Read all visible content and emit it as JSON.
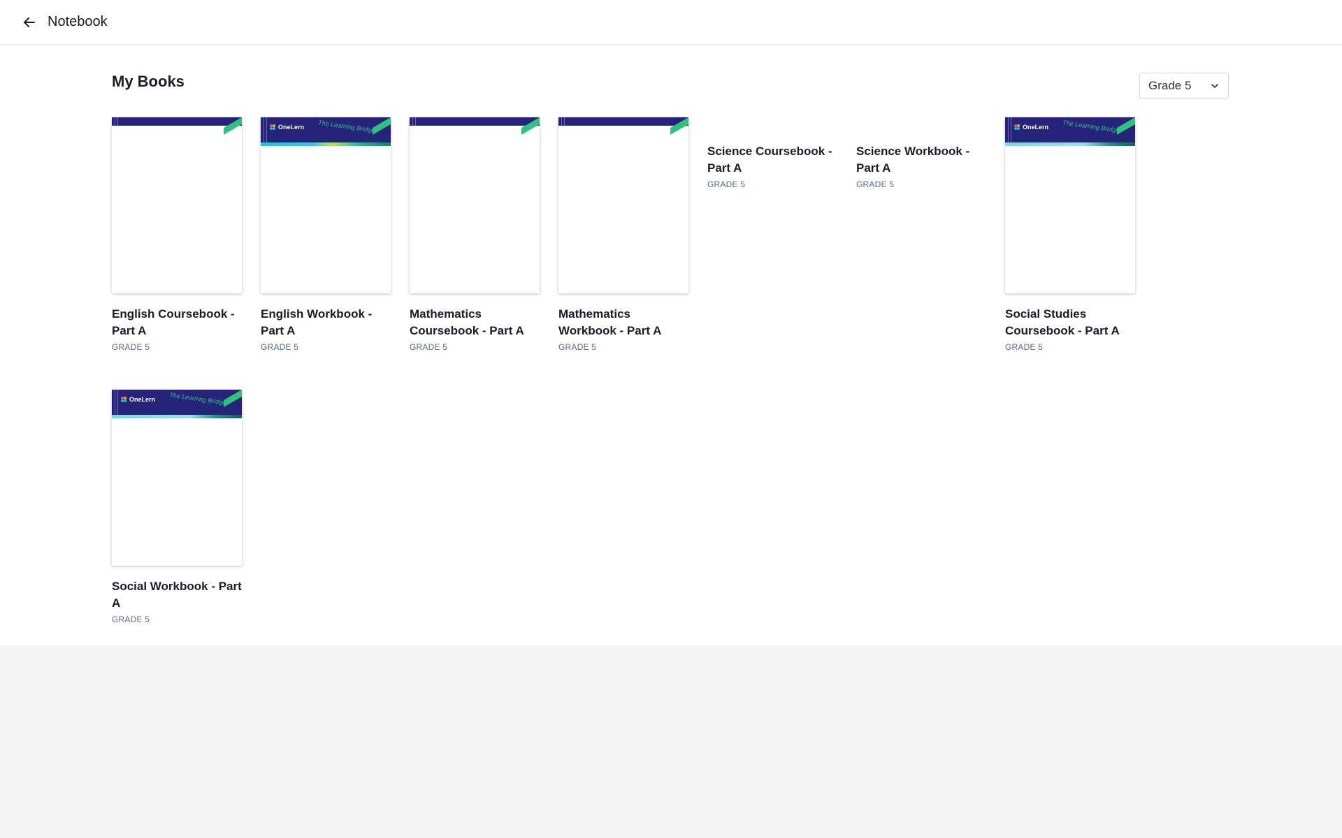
{
  "header": {
    "back_label": "back",
    "title": "Notebook"
  },
  "main": {
    "section_title": "My Books",
    "grade_filter": {
      "selected": "Grade 5"
    }
  },
  "cover_branding": {
    "brand": "OneLern",
    "tagline": "The Learning Bridge"
  },
  "books": [
    {
      "title": "English Coursebook - Part A",
      "grade": "GRADE 5"
    },
    {
      "title": "English Workbook - Part A",
      "grade": "GRADE 5"
    },
    {
      "title": "Mathematics Coursebook - Part A",
      "grade": "GRADE 5"
    },
    {
      "title": "Mathematics Workbook - Part A",
      "grade": "GRADE 5"
    },
    {
      "title": "Science Coursebook - Part A",
      "grade": "GRADE 5"
    },
    {
      "title": "Science Workbook - Part A",
      "grade": "GRADE 5"
    },
    {
      "title": "Social Studies Coursebook - Part A",
      "grade": "GRADE 5"
    },
    {
      "title": "Social Workbook - Part A",
      "grade": "GRADE 5"
    }
  ],
  "colors": {
    "cover_band": "#26237a",
    "accent_green": "#2ec27e",
    "text_primary": "#1c1c28",
    "text_muted": "#5c6880"
  }
}
